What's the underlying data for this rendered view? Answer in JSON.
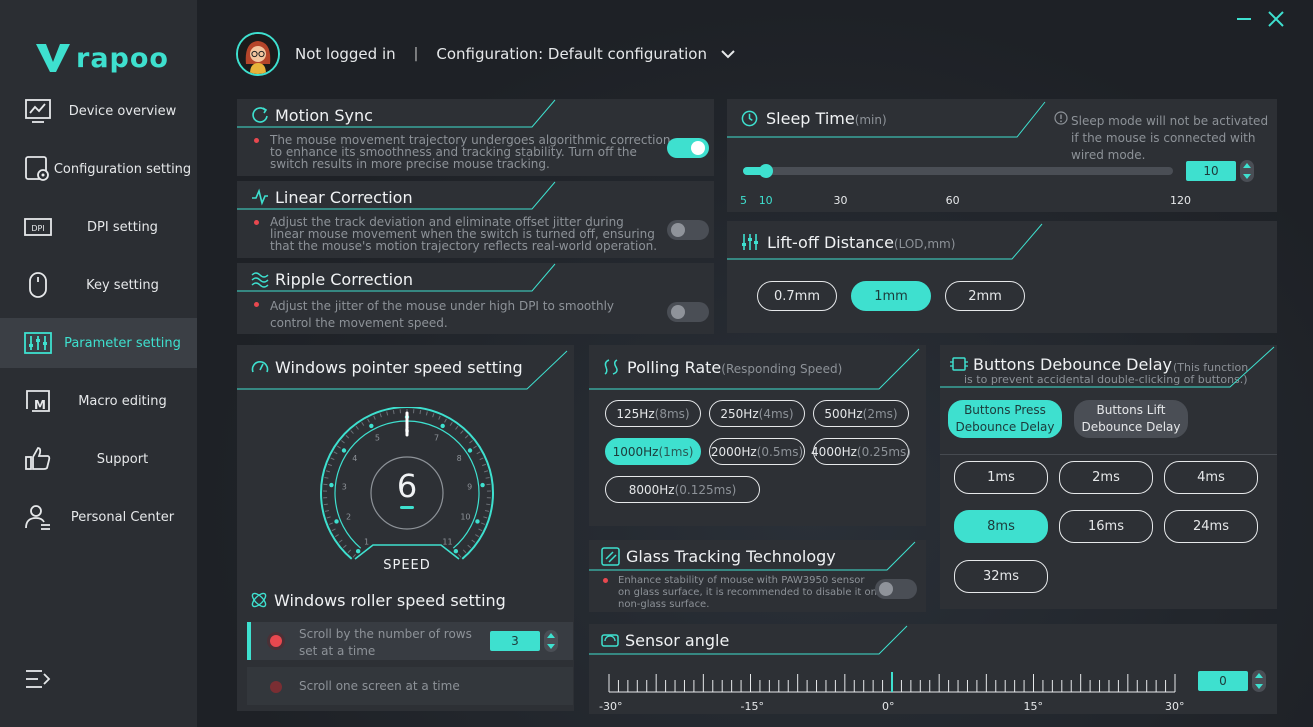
{
  "brand": {
    "name": "rapoo"
  },
  "nav": [
    {
      "label": "Device overview",
      "icon": "monitor-icon"
    },
    {
      "label": "Configuration setting",
      "icon": "config-icon"
    },
    {
      "label": "DPI setting",
      "icon": "dpi-icon"
    },
    {
      "label": "Key setting",
      "icon": "mouse-icon"
    },
    {
      "label": "Parameter setting",
      "icon": "sliders-icon",
      "active": true
    },
    {
      "label": "Macro editing",
      "icon": "macro-icon"
    },
    {
      "label": "Support",
      "icon": "thumbs-up-icon"
    },
    {
      "label": "Personal Center",
      "icon": "user-icon"
    }
  ],
  "header": {
    "login_status": "Not logged in",
    "separator": "|",
    "configuration": "Configuration: Default configuration"
  },
  "motion_sync": {
    "title": "Motion Sync",
    "desc": [
      "The mouse movement trajectory undergoes algorithmic correction",
      "to enhance its smoothness and tracking stability. Turn off the",
      "switch results in more precise mouse tracking."
    ],
    "enabled": true
  },
  "linear_correction": {
    "title": "Linear Correction",
    "desc": [
      "Adjust the track deviation and eliminate offset jitter during",
      "linear mouse movement when the switch is turned off, ensuring",
      "that the mouse's motion trajectory reflects real-world operation."
    ],
    "enabled": false
  },
  "ripple_correction": {
    "title": "Ripple Correction",
    "desc": [
      "Adjust the jitter of the mouse under high DPI to smoothly",
      "control the movement speed."
    ],
    "enabled": false
  },
  "sleep_time": {
    "title": "Sleep Time",
    "unit": "(min)",
    "note": [
      "Sleep mode will not be activated",
      "if the mouse is connected with",
      "wired mode."
    ],
    "value": "10",
    "min": 5,
    "max": 120,
    "ticks": [
      "5",
      "10",
      "30",
      "60",
      "120"
    ],
    "tick_values": [
      5,
      10,
      30,
      60,
      120
    ]
  },
  "lift_off": {
    "title": "Lift-off Distance",
    "unit": "(LOD,mm)",
    "options": [
      "0.7mm",
      "1mm",
      "2mm"
    ],
    "selected": 1
  },
  "pointer_speed": {
    "title": "Windows pointer speed setting",
    "value": "6",
    "label": "SPEED",
    "scale": [
      "1",
      "2",
      "3",
      "4",
      "5",
      "6",
      "7",
      "8",
      "9",
      "10",
      "11"
    ]
  },
  "roller_speed": {
    "title": "Windows roller speed setting",
    "option_rows": "Scroll by the number of rows set at a time",
    "option_rows_lines": [
      "Scroll by the number of rows",
      "set at a time"
    ],
    "rows_value": "3",
    "option_screen": "Scroll one screen at a time"
  },
  "polling_rate": {
    "title": "Polling Rate",
    "subtitle": "(Responding Speed)",
    "options": [
      {
        "rate": "125Hz",
        "time": "(8ms)"
      },
      {
        "rate": "250Hz",
        "time": "(4ms)"
      },
      {
        "rate": "500Hz",
        "time": "(2ms)"
      },
      {
        "rate": "1000Hz",
        "time": "(1ms)"
      },
      {
        "rate": "2000Hz",
        "time": "(0.5ms)"
      },
      {
        "rate": "4000Hz",
        "time": "(0.25ms)"
      },
      {
        "rate": "8000Hz",
        "time": "(0.125ms)"
      }
    ],
    "selected": 3
  },
  "glass_tracking": {
    "title": "Glass Tracking Technology",
    "desc": [
      "Enhance stability of mouse with PAW3950 sensor",
      "on glass surface, it is recommended to disable it on",
      "non-glass surface."
    ],
    "enabled": false
  },
  "debounce": {
    "title": "Buttons Debounce Delay",
    "note_a": "(This function",
    "note_b": "is to prevent accidental double-clicking of buttons.)",
    "tabs": [
      [
        "Buttons Press",
        "Debounce Delay"
      ],
      [
        "Buttons Lift",
        "Debounce Delay"
      ]
    ],
    "active_tab": 0,
    "options": [
      "1ms",
      "2ms",
      "4ms",
      "8ms",
      "16ms",
      "24ms",
      "32ms"
    ],
    "selected": 3
  },
  "sensor_angle": {
    "title": "Sensor angle",
    "value": "0",
    "labels": [
      "-30°",
      "-15°",
      "0°",
      "15°",
      "30°"
    ],
    "min": -30,
    "max": 30
  },
  "colors": {
    "accent": "#3ee0cf",
    "panel": "#2d3035",
    "sidebar": "#2b2e33",
    "alert": "#e8484f"
  }
}
